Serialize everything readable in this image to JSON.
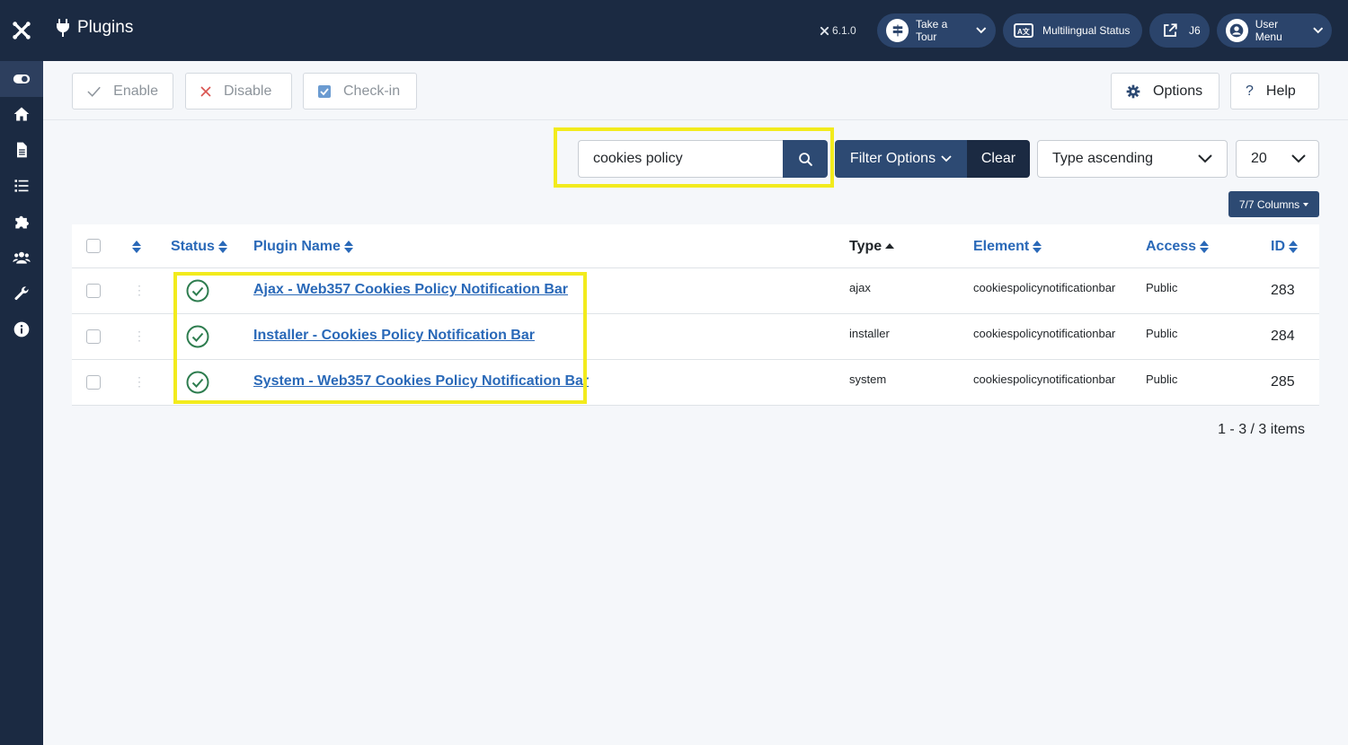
{
  "colors": {
    "sidebar": "#1b2a42",
    "primary": "#2d4a73",
    "link": "#2a69b8",
    "success": "#2e7d4f",
    "highlight": "#f2eb1d"
  },
  "sidebar": {
    "items": [
      {
        "icon": "toggle-icon"
      },
      {
        "icon": "home-icon"
      },
      {
        "icon": "file-icon"
      },
      {
        "icon": "list-icon"
      },
      {
        "icon": "puzzle-icon"
      },
      {
        "icon": "users-icon"
      },
      {
        "icon": "wrench-icon"
      },
      {
        "icon": "info-icon"
      }
    ]
  },
  "header": {
    "title": "Plugins",
    "version": "6.1.0",
    "buttons": {
      "tour": "Take a Tour",
      "multilingual": "Multilingual Status",
      "site": "J6",
      "user": "User Menu"
    }
  },
  "toolbar": {
    "enable": "Enable",
    "disable": "Disable",
    "checkin": "Check-in",
    "options": "Options",
    "help": "Help"
  },
  "search": {
    "value": "cookies policy",
    "filter_options": "Filter Options",
    "clear": "Clear",
    "sort": "Type ascending",
    "limit": "20",
    "columns": "7/7 Columns"
  },
  "table": {
    "headers": {
      "status": "Status",
      "name": "Plugin Name",
      "type": "Type",
      "element": "Element",
      "access": "Access",
      "id": "ID"
    },
    "rows": [
      {
        "name": "Ajax - Web357 Cookies Policy Notification Bar",
        "type": "ajax",
        "element": "cookiespolicynotificationbar",
        "access": "Public",
        "id": "283",
        "status": "enabled"
      },
      {
        "name": "Installer - Cookies Policy Notification Bar",
        "type": "installer",
        "element": "cookiespolicynotificationbar",
        "access": "Public",
        "id": "284",
        "status": "enabled"
      },
      {
        "name": "System - Web357 Cookies Policy Notification Bar",
        "type": "system",
        "element": "cookiespolicynotificationbar",
        "access": "Public",
        "id": "285",
        "status": "enabled"
      }
    ]
  },
  "pagination": {
    "summary": "1 - 3 / 3 items"
  }
}
